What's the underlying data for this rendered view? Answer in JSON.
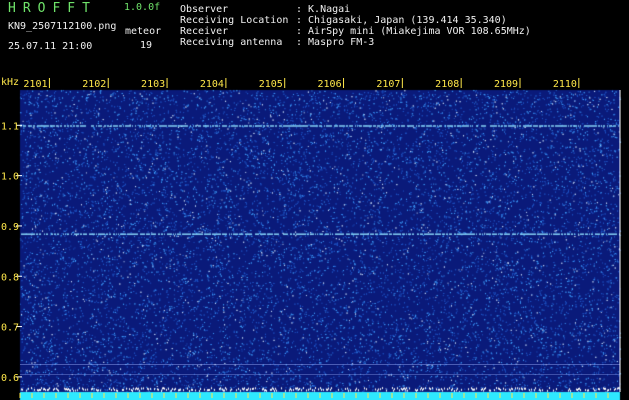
{
  "header": {
    "app_title": "HROFFT",
    "version": "1.0.0f",
    "filename": "KN9_2507112100.png",
    "detector": "meteor",
    "timestamp": "25.07.11 21:00",
    "count": "19"
  },
  "meta": [
    {
      "key": "Observer",
      "value": ": K.Nagai"
    },
    {
      "key": "Receiving Location",
      "value": ": Chigasaki, Japan (139.414 35.340)"
    },
    {
      "key": "Receiver",
      "value": ": AirSpy mini (Miakejima VOR 108.65MHz)"
    },
    {
      "key": "Receiving antenna",
      "value": ": Maspro FM-3"
    }
  ],
  "plot": {
    "y_unit": "kHz",
    "y_ticks": [
      "1.1",
      "1.0",
      "0.9",
      "0.8",
      "0.7",
      "0.6"
    ],
    "y_values": [
      1.1,
      1.0,
      0.9,
      0.8,
      0.7,
      0.6
    ],
    "x_ticks": [
      "2101",
      "2102",
      "2103",
      "2104",
      "2105",
      "2106",
      "2107",
      "2108",
      "2109",
      "2110"
    ],
    "ylim": [
      0.57,
      1.19
    ],
    "xlim": [
      2100.5,
      2110.7
    ],
    "trace_freqs": [
      1.1,
      0.885
    ],
    "colors": {
      "background": "#0a1a7a",
      "noise": "#3fa0ff",
      "trace": "#8fe0ff",
      "baseline": "#2ee8ff",
      "axis_text": "#ffe84a"
    }
  }
}
